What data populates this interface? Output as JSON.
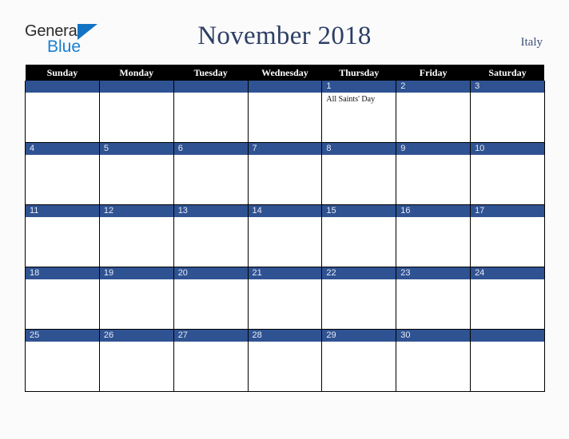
{
  "brand": {
    "word_one": "General",
    "word_two": "Blue",
    "triangle_color": "#1273c4",
    "word_one_color": "#2b2b2b",
    "word_two_color": "#1a7fd4"
  },
  "header": {
    "title": "November 2018",
    "region": "Italy",
    "title_color": "#2d3f65",
    "region_color": "#3c4f75"
  },
  "calendar": {
    "month": "November",
    "year": "2018",
    "accent_color": "#2f5292",
    "header_bg": "#000000",
    "header_text_color": "#ffffff",
    "day_names": [
      "Sunday",
      "Monday",
      "Tuesday",
      "Wednesday",
      "Thursday",
      "Friday",
      "Saturday"
    ],
    "weeks": [
      [
        {
          "date": "",
          "events": []
        },
        {
          "date": "",
          "events": []
        },
        {
          "date": "",
          "events": []
        },
        {
          "date": "",
          "events": []
        },
        {
          "date": "1",
          "events": [
            "All Saints' Day"
          ]
        },
        {
          "date": "2",
          "events": []
        },
        {
          "date": "3",
          "events": []
        }
      ],
      [
        {
          "date": "4",
          "events": []
        },
        {
          "date": "5",
          "events": []
        },
        {
          "date": "6",
          "events": []
        },
        {
          "date": "7",
          "events": []
        },
        {
          "date": "8",
          "events": []
        },
        {
          "date": "9",
          "events": []
        },
        {
          "date": "10",
          "events": []
        }
      ],
      [
        {
          "date": "11",
          "events": []
        },
        {
          "date": "12",
          "events": []
        },
        {
          "date": "13",
          "events": []
        },
        {
          "date": "14",
          "events": []
        },
        {
          "date": "15",
          "events": []
        },
        {
          "date": "16",
          "events": []
        },
        {
          "date": "17",
          "events": []
        }
      ],
      [
        {
          "date": "18",
          "events": []
        },
        {
          "date": "19",
          "events": []
        },
        {
          "date": "20",
          "events": []
        },
        {
          "date": "21",
          "events": []
        },
        {
          "date": "22",
          "events": []
        },
        {
          "date": "23",
          "events": []
        },
        {
          "date": "24",
          "events": []
        }
      ],
      [
        {
          "date": "25",
          "events": []
        },
        {
          "date": "26",
          "events": []
        },
        {
          "date": "27",
          "events": []
        },
        {
          "date": "28",
          "events": []
        },
        {
          "date": "29",
          "events": []
        },
        {
          "date": "30",
          "events": []
        },
        {
          "date": "",
          "events": []
        }
      ]
    ]
  }
}
